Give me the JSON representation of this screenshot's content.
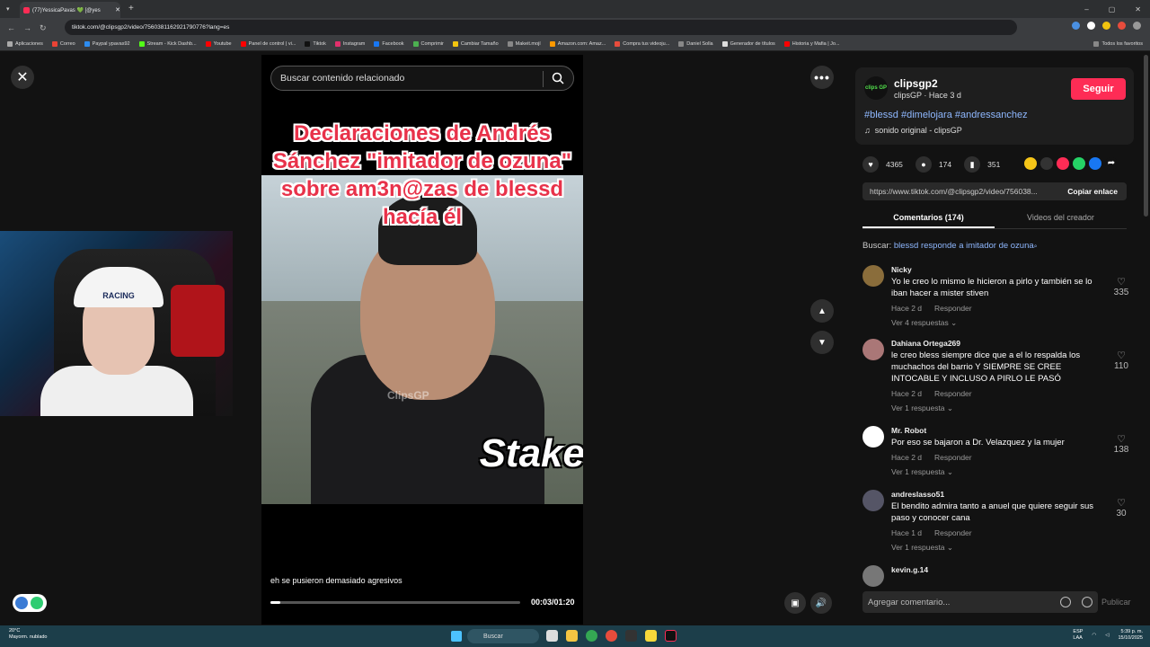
{
  "browser": {
    "tab_title": "(77)YessicaPavas 💚 [@yes",
    "url": "tiktok.com/@clipsgp2/video/7560381162921790776?lang=es",
    "win_min": "–",
    "win_max": "▢",
    "win_close": "✕",
    "bookmarks": [
      "Aplicaciones",
      "Correo",
      "Paypal ypavas92",
      "Stream - Kick Dashb...",
      "Youtube",
      "Panel de control | vi...",
      "Tiktok",
      "Instagram",
      "Facebook",
      "Comprimir",
      "Cambiar Tamaño",
      "Makeit.mojí",
      "Amazon.com: Amaz...",
      "Compra tus videoju...",
      "Daniel Solla",
      "Generador de títulos",
      "Historia y Mafia | Jo..."
    ],
    "bookmarks_right": "Todos los favoritos"
  },
  "player": {
    "search_placeholder": "Buscar contenido relacionado",
    "headline": "Declaraciones de Andrés Sánchez \"imitador de ozuna\" sobre am3n@zas de blessd hacía él",
    "watermark": "ClipsGP",
    "sponsor": "Stake",
    "caption": "eh se pusieron demasiado agresivos",
    "time": "00:03/01:20",
    "progress": 0.04
  },
  "author": {
    "username": "clipsgp2",
    "subline": "clipsGP · Hace 3 d",
    "follow": "Seguir",
    "avatar_text": "clips GP",
    "tags": "#blessd #dimelojara #andressanchez",
    "sound": "sonido original - clipsGP"
  },
  "stats": {
    "likes": "4365",
    "comments": "174",
    "saves": "351"
  },
  "link": {
    "url": "https://www.tiktok.com/@clipsgp2/video/756038...",
    "copy": "Copiar enlace"
  },
  "tabs": {
    "comments": "Comentarios (174)",
    "videos": "Videos del creador"
  },
  "search_related": {
    "label": "Buscar:",
    "query": "blessd responde a imitador de ozuna"
  },
  "comments": [
    {
      "name": "Nicky",
      "text": "Yo le creo lo mismo le hicieron a pirlo y también se lo iban hacer a mister stiven",
      "time": "Hace 2 d",
      "reply": "Responder",
      "more": "Ver 4 respuestas",
      "likes": "335"
    },
    {
      "name": "Dahiana Ortega269",
      "text": "le creo bless siempre dice que a el lo respalda los muchachos del barrio Y SIEMPRE SE CREE INTOCABLE Y INCLUSO A PIRLO LE PASÓ",
      "time": "Hace 2 d",
      "reply": "Responder",
      "more": "Ver 1 respuesta",
      "likes": "110"
    },
    {
      "name": "Mr. Robot",
      "text": "Por eso se bajaron a Dr. Velazquez y la mujer",
      "time": "Hace 2 d",
      "reply": "Responder",
      "more": "Ver 1 respuesta",
      "likes": "138"
    },
    {
      "name": "andreslasso51",
      "text": "El bendito admira tanto a anuel que quiere seguir sus paso y conocer cana",
      "time": "Hace 1 d",
      "reply": "Responder",
      "more": "Ver 1 respuesta",
      "likes": "30"
    },
    {
      "name": "kevin.g.14"
    }
  ],
  "compose": {
    "placeholder": "Agregar comentario...",
    "publish": "Publicar"
  },
  "webcam": {
    "cap_text": "RACING"
  },
  "taskbar": {
    "temp": "20°C",
    "weather": "Mayorm. nublado",
    "search": "Buscar",
    "lang": "ESP",
    "lang2": "LAA",
    "time": "5:39 p. m.",
    "date": "15/10/2025"
  },
  "colors": {
    "accent": "#fe2c55",
    "link": "#8fb8ff",
    "headline": "#e8324a"
  }
}
